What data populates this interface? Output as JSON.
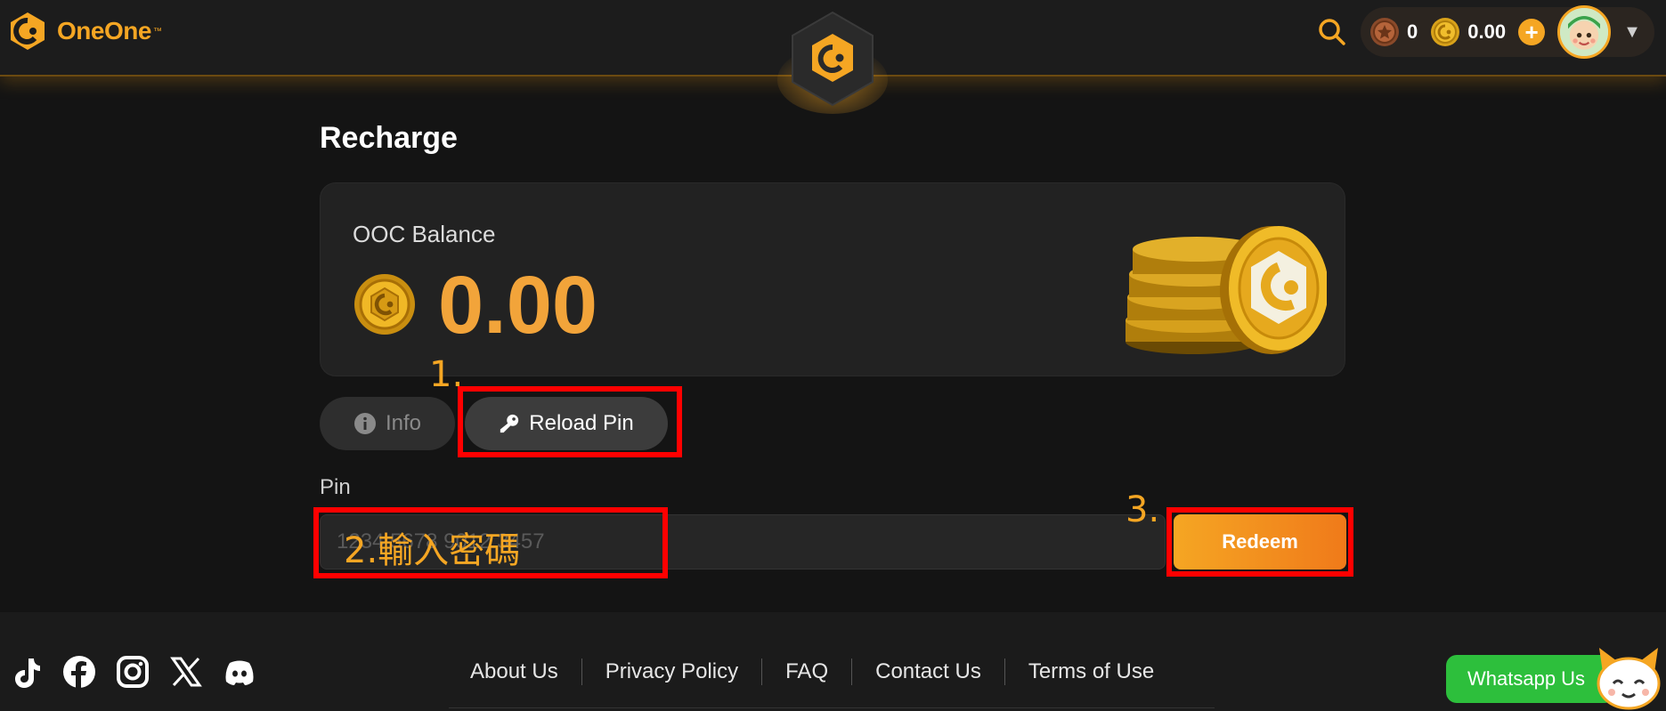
{
  "header": {
    "brand": "OneOne",
    "brand_tm": "™",
    "wallet": {
      "medal_value": "0",
      "coin_value": "0.00",
      "plus": "+"
    },
    "caret": "▼"
  },
  "main": {
    "title": "Recharge",
    "balance": {
      "label": "OOC Balance",
      "amount": "0.00"
    },
    "tabs": [
      {
        "label": "Info"
      },
      {
        "label": "Reload Pin"
      }
    ],
    "pin": {
      "label": "Pin",
      "placeholder": "1234 5678 9012 3457",
      "value": ""
    },
    "redeem_label": "Redeem"
  },
  "annotations": {
    "step1": "1.",
    "step2": "2.輸入密碼",
    "step3": "3."
  },
  "footer": {
    "links": [
      "About Us",
      "Privacy Policy",
      "FAQ",
      "Contact Us",
      "Terms of Use"
    ],
    "social_icons": [
      "tiktok-icon",
      "facebook-icon",
      "instagram-icon",
      "x-icon",
      "discord-icon"
    ],
    "whatsapp_label": "Whatsapp Us"
  },
  "colors": {
    "accent": "#f5a623",
    "background": "#141414",
    "card": "#222222",
    "annotation": "#ff0000",
    "whatsapp": "#2dbf3c"
  }
}
